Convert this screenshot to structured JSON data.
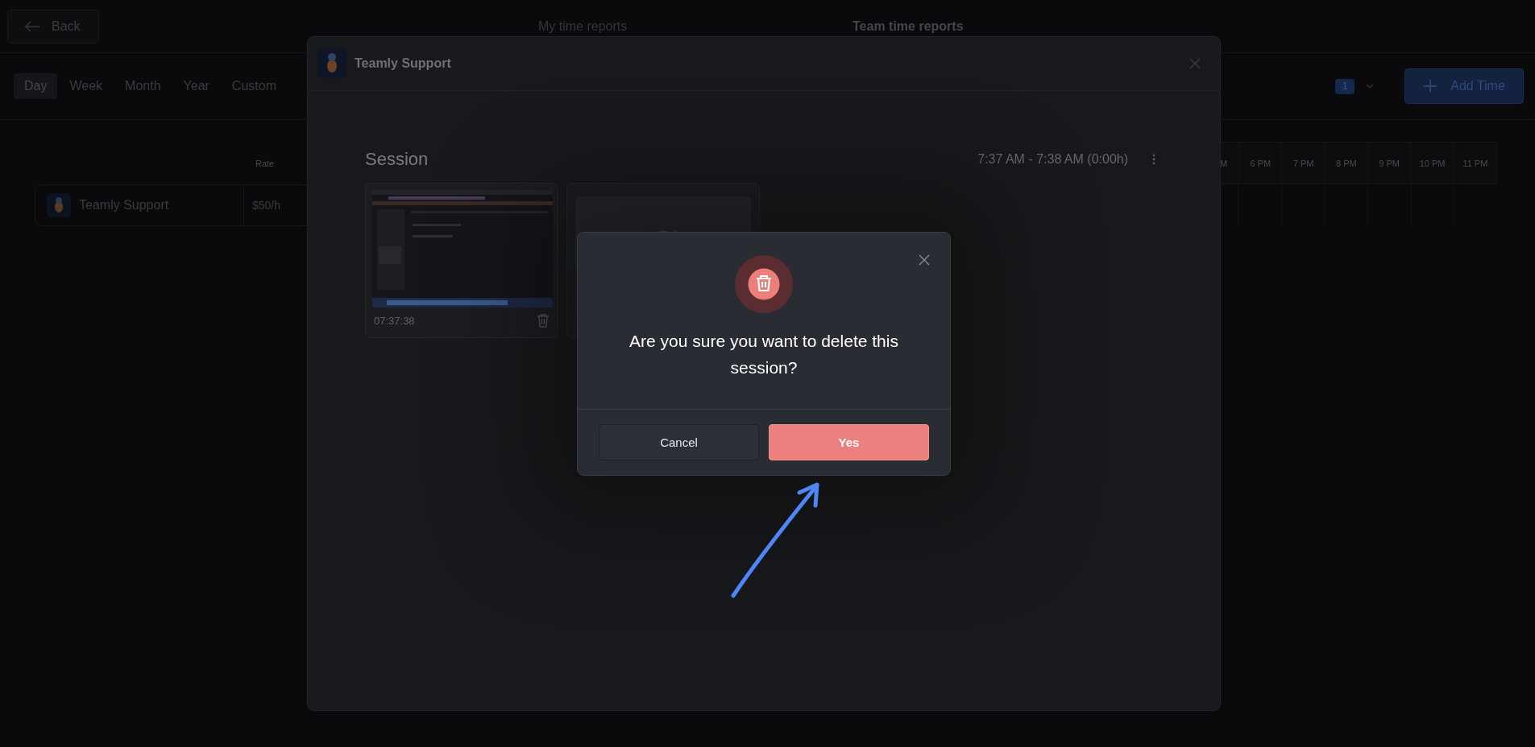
{
  "header": {
    "back": "Back",
    "nav": [
      {
        "label": "My time reports",
        "selected": false
      },
      {
        "label": "Team time reports",
        "selected": true
      }
    ]
  },
  "periods": [
    {
      "label": "Day",
      "selected": true
    },
    {
      "label": "Week",
      "selected": false
    },
    {
      "label": "Month",
      "selected": false
    },
    {
      "label": "Year",
      "selected": false
    },
    {
      "label": "Custom",
      "selected": false
    }
  ],
  "filter_badge": "1",
  "add_button": "Add Time",
  "table": {
    "columns": [
      "Rate"
    ],
    "rows": [
      {
        "name": "Teamly Support",
        "rate": "$50/h"
      }
    ]
  },
  "timeline": {
    "hours": [
      "M",
      "6 PM",
      "7 PM",
      "8 PM",
      "9 PM",
      "10 PM",
      "11 PM"
    ]
  },
  "modal": {
    "title": "Teamly Support",
    "session": {
      "title": "Session",
      "time_range": "7:37 AM - 7:38 AM (0:00h)",
      "screenshots": [
        {
          "kind": "image",
          "time": "07:37:38"
        },
        {
          "kind": "placeholder"
        }
      ]
    }
  },
  "dialog": {
    "message": "Are you sure you want to delete this session?",
    "buttons": [
      {
        "label": "Cancel",
        "kind": "secondary"
      },
      {
        "label": "Yes",
        "kind": "primary"
      }
    ]
  }
}
